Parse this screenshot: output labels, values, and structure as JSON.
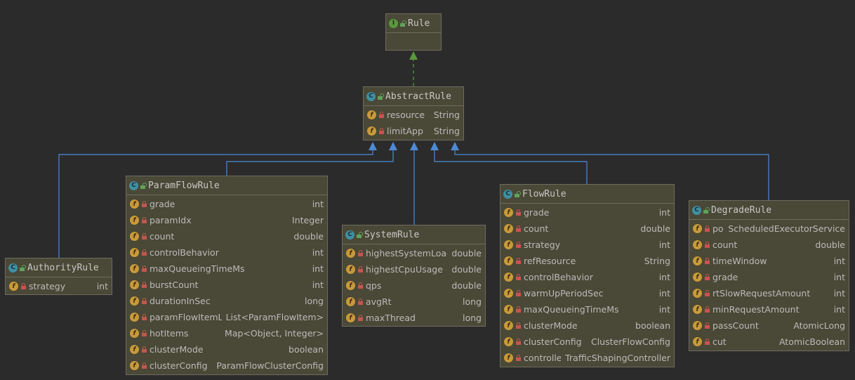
{
  "classes": {
    "rule": {
      "name": "Rule",
      "kind": "interface",
      "fields": []
    },
    "abstract": {
      "name": "AbstractRule",
      "kind": "abstract-class",
      "fields": [
        {
          "name": "resource",
          "type": "String"
        },
        {
          "name": "limitApp",
          "type": "String"
        }
      ]
    },
    "authority": {
      "name": "AuthorityRule",
      "kind": "class",
      "fields": [
        {
          "name": "strategy",
          "type": "int"
        }
      ]
    },
    "param": {
      "name": "ParamFlowRule",
      "kind": "class",
      "fields": [
        {
          "name": "grade",
          "type": "int"
        },
        {
          "name": "paramIdx",
          "type": "Integer"
        },
        {
          "name": "count",
          "type": "double"
        },
        {
          "name": "controlBehavior",
          "type": "int"
        },
        {
          "name": "maxQueueingTimeMs",
          "type": "int"
        },
        {
          "name": "burstCount",
          "type": "int"
        },
        {
          "name": "durationInSec",
          "type": "long"
        },
        {
          "name": "paramFlowItemList",
          "type": "List<ParamFlowItem>"
        },
        {
          "name": "hotItems",
          "type": "Map<Object, Integer>"
        },
        {
          "name": "clusterMode",
          "type": "boolean"
        },
        {
          "name": "clusterConfig",
          "type": "ParamFlowClusterConfig"
        }
      ]
    },
    "system": {
      "name": "SystemRule",
      "kind": "class",
      "fields": [
        {
          "name": "highestSystemLoad",
          "type": "double"
        },
        {
          "name": "highestCpuUsage",
          "type": "double"
        },
        {
          "name": "qps",
          "type": "double"
        },
        {
          "name": "avgRt",
          "type": "long"
        },
        {
          "name": "maxThread",
          "type": "long"
        }
      ]
    },
    "flow": {
      "name": "FlowRule",
      "kind": "class",
      "fields": [
        {
          "name": "grade",
          "type": "int"
        },
        {
          "name": "count",
          "type": "double"
        },
        {
          "name": "strategy",
          "type": "int"
        },
        {
          "name": "refResource",
          "type": "String"
        },
        {
          "name": "controlBehavior",
          "type": "int"
        },
        {
          "name": "warmUpPeriodSec",
          "type": "int"
        },
        {
          "name": "maxQueueingTimeMs",
          "type": "int"
        },
        {
          "name": "clusterMode",
          "type": "boolean"
        },
        {
          "name": "clusterConfig",
          "type": "ClusterFlowConfig"
        },
        {
          "name": "controller",
          "type": "TrafficShapingController"
        }
      ]
    },
    "degrade": {
      "name": "DegradeRule",
      "kind": "class",
      "fields": [
        {
          "name": "pool",
          "type": "ScheduledExecutorService"
        },
        {
          "name": "count",
          "type": "double"
        },
        {
          "name": "timeWindow",
          "type": "int"
        },
        {
          "name": "grade",
          "type": "int"
        },
        {
          "name": "rtSlowRequestAmount",
          "type": "int"
        },
        {
          "name": "minRequestAmount",
          "type": "int"
        },
        {
          "name": "passCount",
          "type": "AtomicLong"
        },
        {
          "name": "cut",
          "type": "AtomicBoolean"
        }
      ]
    }
  },
  "colors": {
    "background": "#2b2b2b",
    "node_fill": "#4a4836",
    "node_border": "#6e6c60",
    "extends_edge": "#4d8ad6",
    "implements_edge": "#5a9a3c"
  },
  "icons": {
    "interface": "interface-icon",
    "class": "class-icon",
    "field": "field-icon",
    "private": "lock-icon",
    "public": "public-icon"
  }
}
